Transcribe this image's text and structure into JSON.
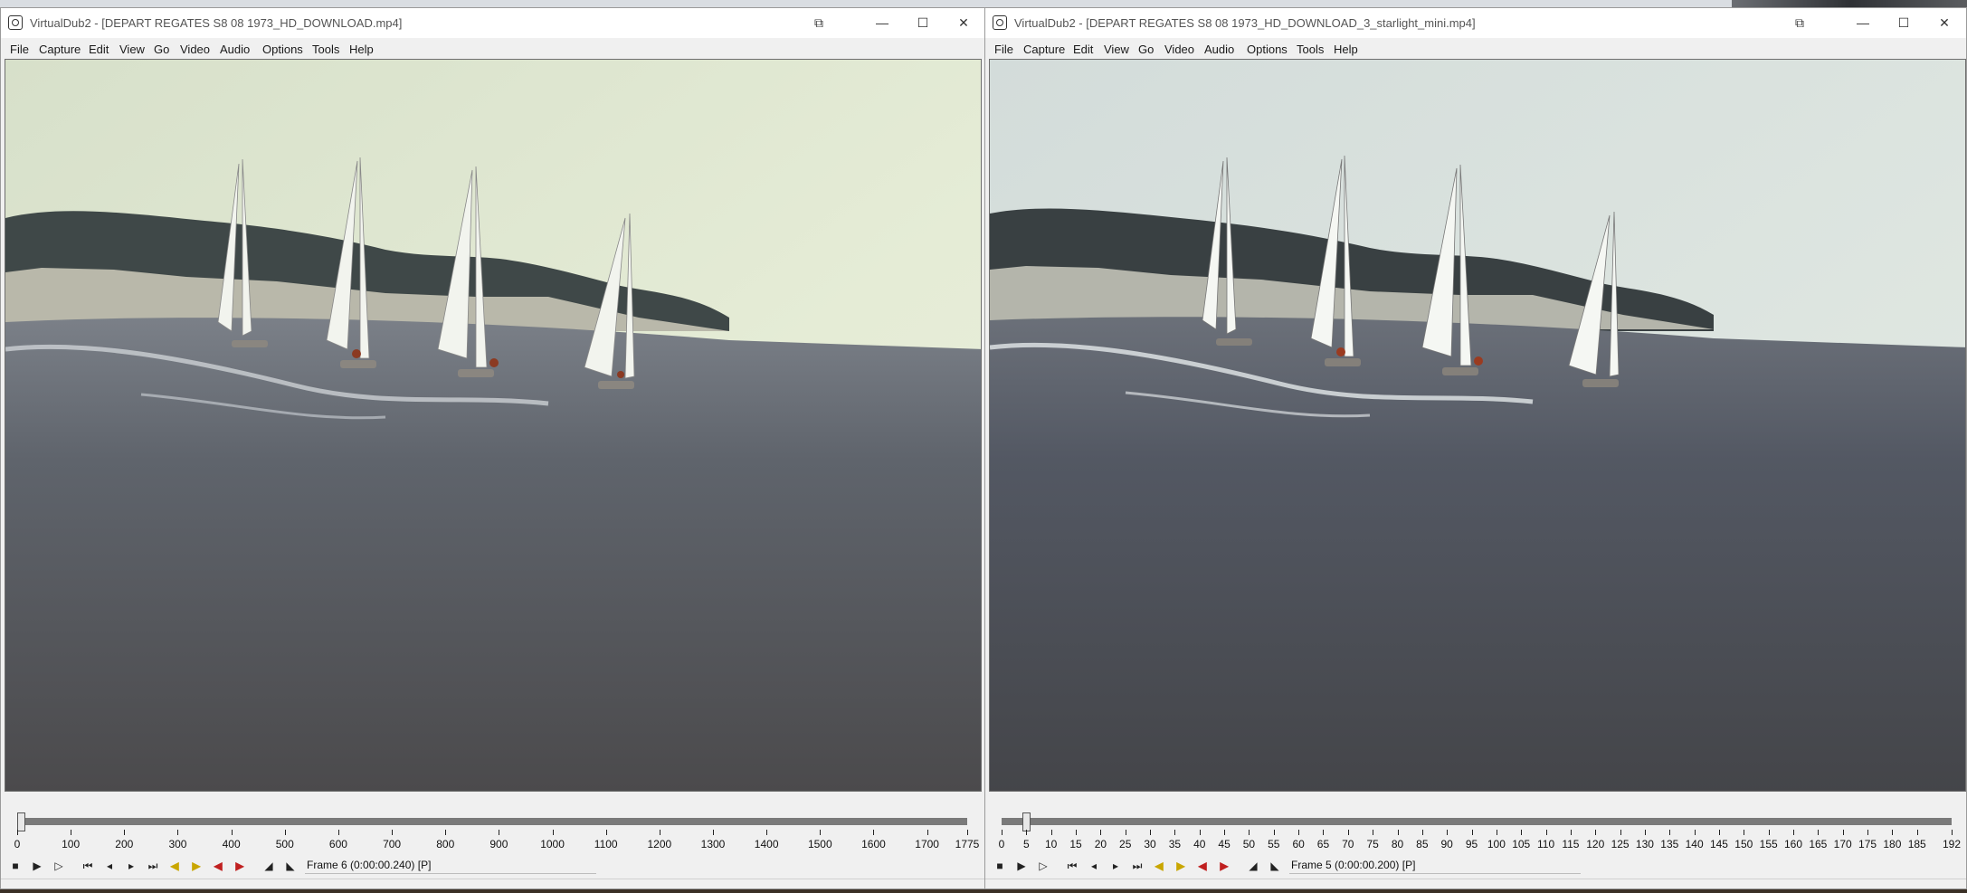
{
  "windows": [
    {
      "title": "VirtualDub2  - [DEPART REGATES S8 08 1973_HD_DOWNLOAD.mp4]",
      "menu": [
        "File",
        "Capture",
        "Edit",
        "View",
        "Go",
        "Video",
        "Audio",
        "Options",
        "Tools",
        "Help"
      ],
      "timeline": {
        "labels": [
          "0",
          "100",
          "200",
          "300",
          "400",
          "500",
          "600",
          "700",
          "800",
          "900",
          "1000",
          "1100",
          "1200",
          "1300",
          "1400",
          "1500",
          "1600",
          "1700",
          "1775"
        ],
        "values": [
          0,
          100,
          200,
          300,
          400,
          500,
          600,
          700,
          800,
          900,
          1000,
          1100,
          1200,
          1300,
          1400,
          1500,
          1600,
          1700,
          1775
        ],
        "max": 1775,
        "current_frame": 6
      },
      "frame_text": "Frame 6 (0:00:00.240) [P]"
    },
    {
      "title": "VirtualDub2  - [DEPART REGATES S8 08 1973_HD_DOWNLOAD_3_starlight_mini.mp4]",
      "menu": [
        "File",
        "Capture",
        "Edit",
        "View",
        "Go",
        "Video",
        "Audio",
        "Options",
        "Tools",
        "Help"
      ],
      "timeline": {
        "labels": [
          "0",
          "5",
          "10",
          "15",
          "20",
          "25",
          "30",
          "35",
          "40",
          "45",
          "50",
          "55",
          "60",
          "65",
          "70",
          "75",
          "80",
          "85",
          "90",
          "95",
          "100",
          "105",
          "110",
          "115",
          "120",
          "125",
          "130",
          "135",
          "140",
          "145",
          "150",
          "155",
          "160",
          "165",
          "170",
          "175",
          "180",
          "185",
          "192"
        ],
        "values": [
          0,
          5,
          10,
          15,
          20,
          25,
          30,
          35,
          40,
          45,
          50,
          55,
          60,
          65,
          70,
          75,
          80,
          85,
          90,
          95,
          100,
          105,
          110,
          115,
          120,
          125,
          130,
          135,
          140,
          145,
          150,
          155,
          160,
          165,
          170,
          175,
          180,
          185,
          192
        ],
        "max": 192,
        "current_frame": 5
      },
      "frame_text": "Frame 5 (0:00:00.200) [P]"
    }
  ],
  "icons": {
    "minimize": "—",
    "maximize": "☐",
    "close": "✕",
    "window_mode": "⧉"
  },
  "colors": {
    "sky_left": "#e3ead5",
    "sky_right": "#dfe6e2",
    "sea_left": "#5a5e66",
    "sea_right": "#4a4f5b"
  }
}
